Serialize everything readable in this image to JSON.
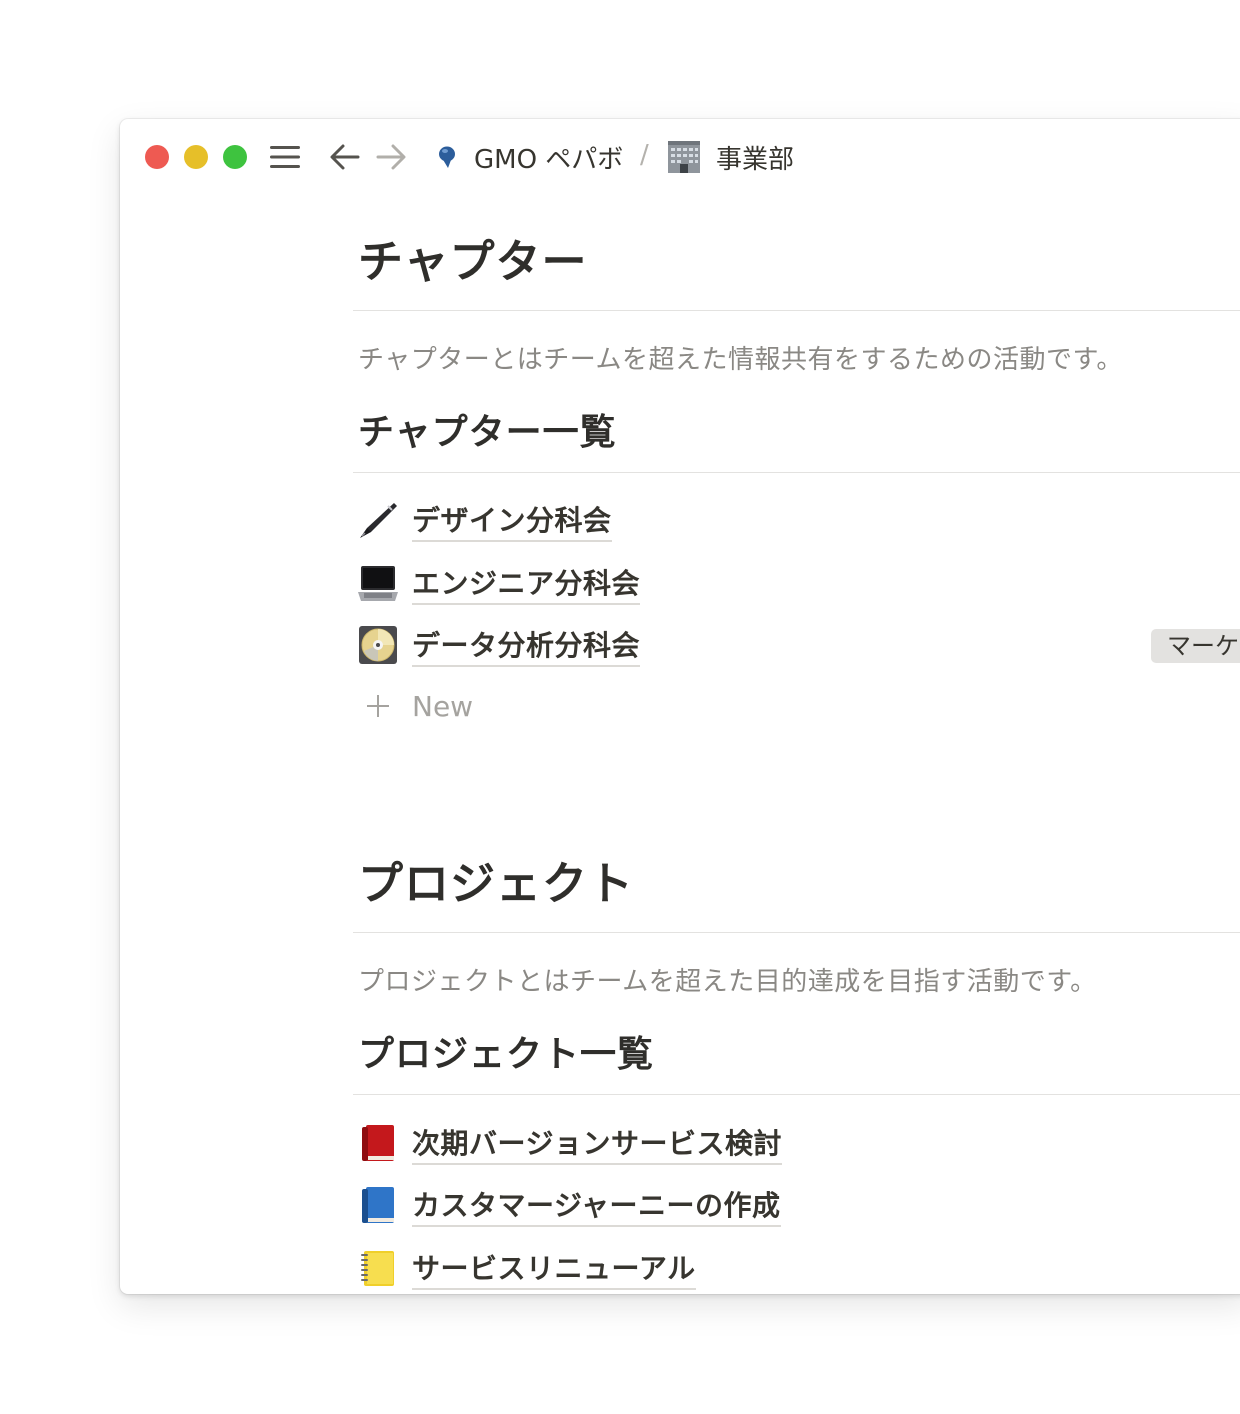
{
  "titlebar": {
    "breadcrumb": [
      {
        "label": "GMO ペパボ",
        "icon": "pin-icon"
      },
      {
        "label": "事業部",
        "icon": "office-building-icon"
      }
    ],
    "separator": "/"
  },
  "colors": {
    "close": "#ee5a52",
    "minimize": "#e6bf29",
    "zoom": "#3ec33f",
    "text": "#37352f",
    "muted": "#8a8884"
  },
  "chapter": {
    "title": "チャプター",
    "description": "チャプターとはチームを超えた情報共有をするための活動です。",
    "list_title": "チャプター一覧",
    "items": [
      {
        "label": "デザイン分科会",
        "icon": "pen-icon"
      },
      {
        "label": "エンジニア分科会",
        "icon": "laptop-icon"
      },
      {
        "label": "データ分析分科会",
        "icon": "dvd-icon",
        "tag": "マーケ"
      }
    ],
    "new_label": "New"
  },
  "project": {
    "title": "プロジェクト",
    "description": "プロジェクトとはチームを超えた目的達成を目指す活動です。",
    "list_title": "プロジェクト一覧",
    "items": [
      {
        "label": "次期バージョンサービス検討",
        "icon": "red-book-icon"
      },
      {
        "label": "カスタマージャーニーの作成",
        "icon": "blue-book-icon"
      },
      {
        "label": "サービスリニューアル",
        "icon": "yellow-notebook-icon"
      }
    ]
  }
}
